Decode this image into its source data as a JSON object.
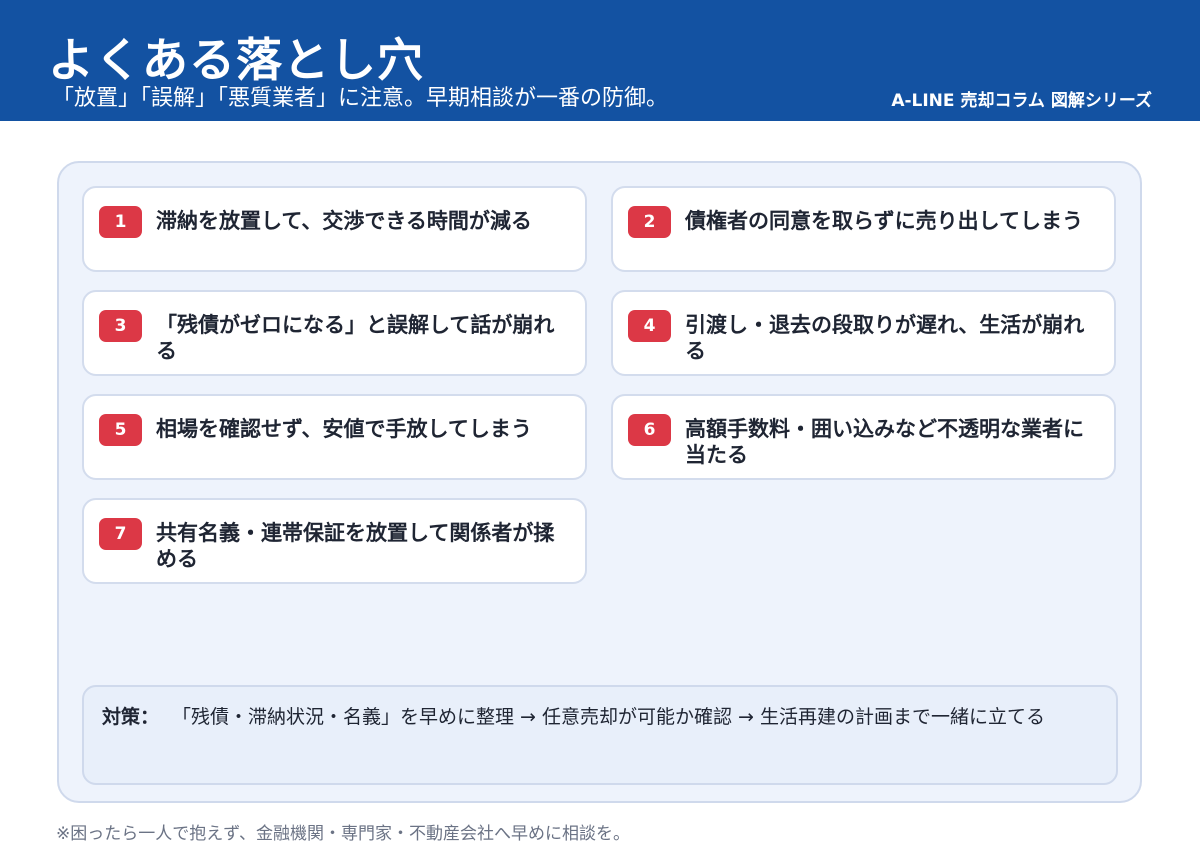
{
  "header": {
    "title": "よくある落とし穴",
    "subtitle": "「放置」「誤解」「悪質業者」に注意。早期相談が一番の防御。",
    "brand": "A-LINE 売却コラム 図解シリーズ"
  },
  "pitfalls": [
    {
      "number": "1",
      "text": "滞納を放置して、交渉できる時間が減る"
    },
    {
      "number": "2",
      "text": "債権者の同意を取らずに売り出してしまう"
    },
    {
      "number": "3",
      "text": "「残債がゼロになる」と誤解して話が崩れる"
    },
    {
      "number": "4",
      "text": "引渡し・退去の段取りが遅れ、生活が崩れる"
    },
    {
      "number": "5",
      "text": "相場を確認せず、安値で手放してしまう"
    },
    {
      "number": "6",
      "text": "高額手数料・囲い込みなど不透明な業者に当たる"
    },
    {
      "number": "7",
      "text": "共有名義・連帯保証を放置して関係者が揉める"
    }
  ],
  "advice": {
    "label": "対策：",
    "text": "「残債・滞納状況・名義」を早めに整理 → 任意売却が可能か確認 → 生活再建の計画まで一緒に立てる"
  },
  "footnote": "※困ったら一人で抱えず、金融機関・専門家・不動産会社へ早めに相談を。",
  "colors": {
    "header_bg": "#1352a2",
    "badge": "#dc3846",
    "panel_bg": "#eef3fc",
    "advice_bg": "#e8effa"
  }
}
